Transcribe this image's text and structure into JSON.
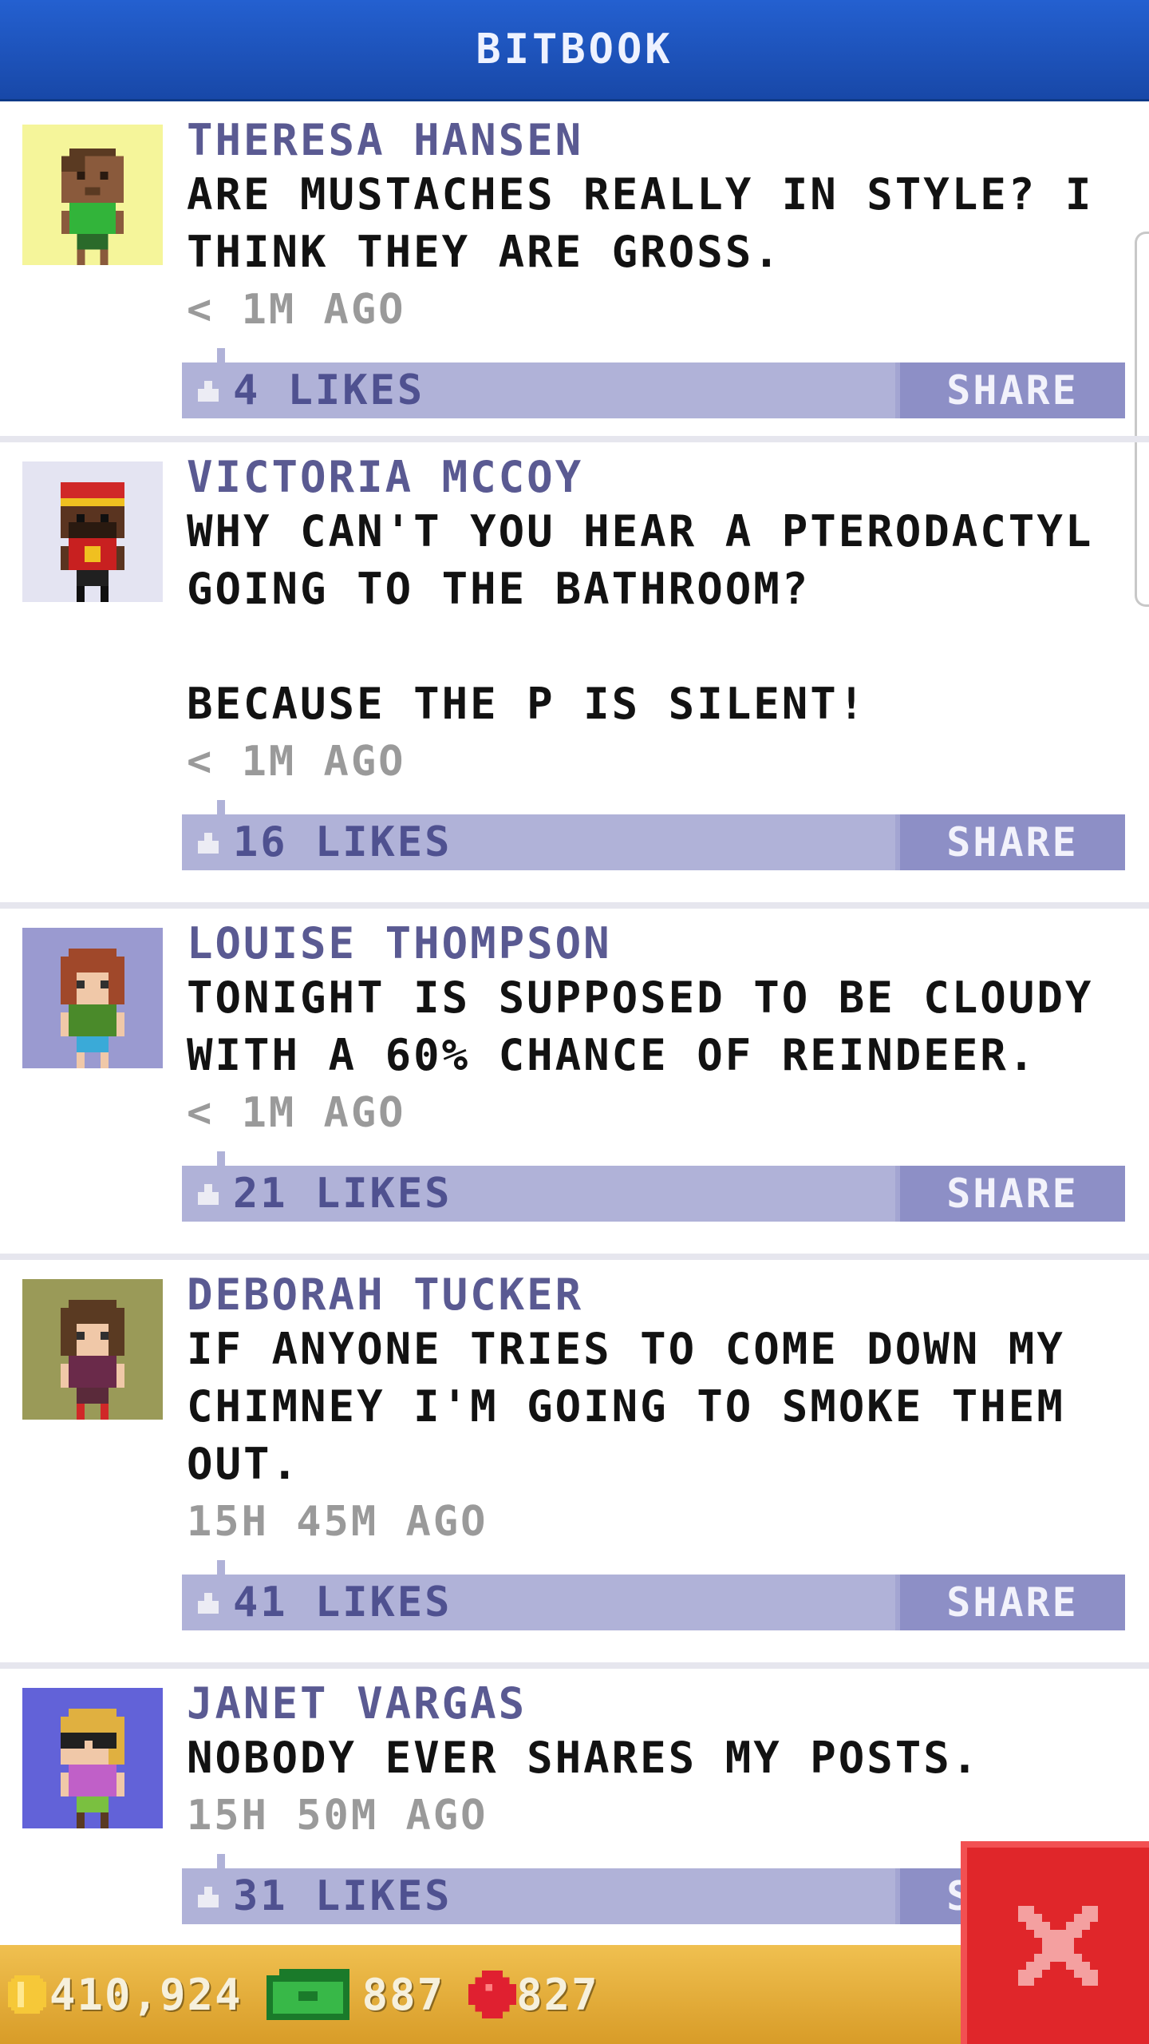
{
  "header": {
    "title": "BITBOOK"
  },
  "posts": [
    {
      "author": "THERESA HANSEN",
      "text": "ARE MUSTACHES REALLY IN STYLE? I\nTHINK THEY ARE GROSS.",
      "time": "< 1M AGO",
      "likes": "4 LIKES",
      "share": "SHARE",
      "avatar_bg": "#f5f59a"
    },
    {
      "author": "VICTORIA MCCOY",
      "text": "WHY CAN'T YOU HEAR A PTERODACTYL\nGOING TO THE BATHROOM?\n\nBECAUSE THE P IS SILENT!",
      "time": "< 1M AGO",
      "likes": "16 LIKES",
      "share": "SHARE",
      "avatar_bg": "#e4e4f2"
    },
    {
      "author": "LOUISE THOMPSON",
      "text": "TONIGHT IS SUPPOSED TO BE CLOUDY\nWITH A 60% CHANCE OF REINDEER.",
      "time": "< 1M AGO",
      "likes": "21 LIKES",
      "share": "SHARE",
      "avatar_bg": "#9a9ad0"
    },
    {
      "author": "DEBORAH TUCKER",
      "text": "IF ANYONE TRIES TO COME DOWN MY\nCHIMNEY I'M GOING TO SMOKE THEM\nOUT.",
      "time": "15H 45M AGO",
      "likes": "41 LIKES",
      "share": "SHARE",
      "avatar_bg": "#9a9a58"
    },
    {
      "author": "JANET VARGAS",
      "text": "NOBODY EVER SHARES MY POSTS.",
      "time": "15H 50M AGO",
      "likes": "31 LIKES",
      "share": "SHARE",
      "avatar_bg": "#6262d8"
    }
  ],
  "stats": {
    "coins": "410,924",
    "bux": "887",
    "gems": "827"
  },
  "colors": {
    "header": "#1f56c0",
    "author": "#5a5a92",
    "like_bar": "#b0b2d8",
    "share_button": "#8d8fc6",
    "bottom_bar": "#e4ac38",
    "close_button": "#e0262a"
  }
}
